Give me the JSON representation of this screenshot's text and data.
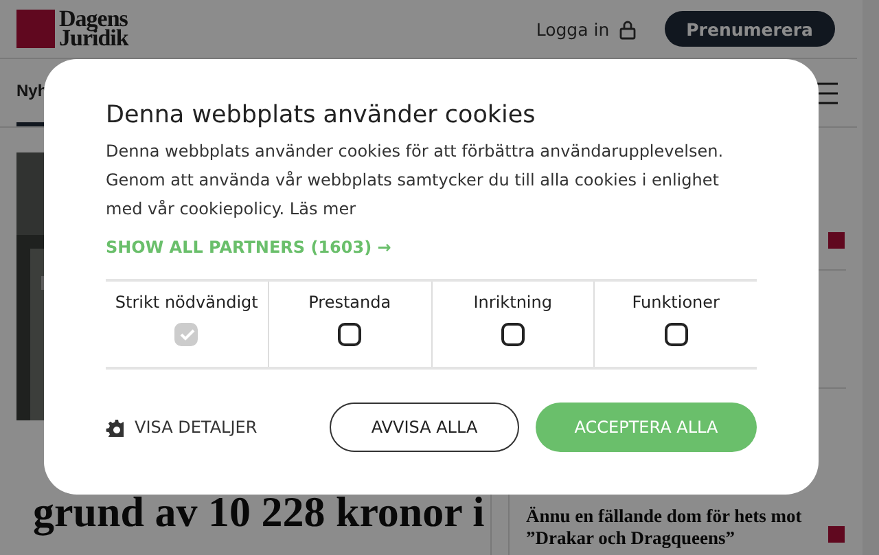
{
  "header": {
    "logo": {
      "line_1": "Dagens",
      "line_2": "Juridik"
    },
    "login": "Logga in",
    "subscribe": "Prenumerera"
  },
  "nav": {
    "items": [
      {
        "label": "Nyh",
        "selected": true
      }
    ]
  },
  "main_article": {
    "headline": "grund av 10 228 kronor i"
  },
  "side_news": [
    {
      "title": "Ännu en fällande dom för hets mot ”Drakar och Dragqueens”"
    }
  ],
  "cookie_dialog": {
    "title": "Denna webbplats använder cookies",
    "body": "Denna webbplats använder cookies för att förbättra användarupplevelsen. Genom att använda vår webbplats samtycker du till alla cookies i enlighet med vår cookiepolicy. Läs mer",
    "partners_link": "SHOW ALL PARTNERS (1603) →",
    "categories": [
      {
        "label": "Strikt nödvändigt",
        "checked": true,
        "disabled": true
      },
      {
        "label": "Prestanda",
        "checked": false,
        "disabled": false
      },
      {
        "label": "Inriktning",
        "checked": false,
        "disabled": false
      },
      {
        "label": "Funktioner",
        "checked": false,
        "disabled": false
      }
    ],
    "details": "VISA DETALJER",
    "reject": "AVVISA ALLA",
    "accept": "ACCEPTERA ALLA"
  }
}
